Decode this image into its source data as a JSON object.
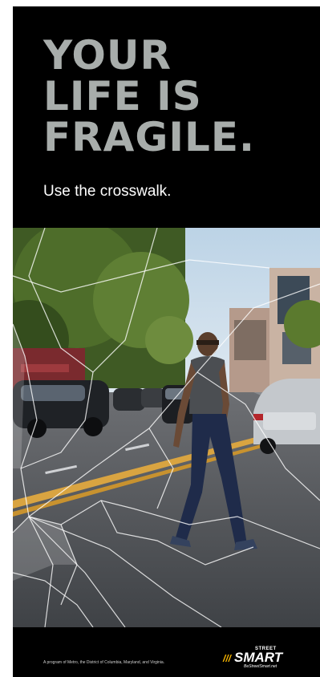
{
  "headline": {
    "line1": "YOUR",
    "line2": "LIFE IS",
    "line3": "FRAGILE."
  },
  "subhead": "Use the crosswalk.",
  "footer": {
    "text": "A program of Metro, the District of Columbia, Maryland, and Virginia."
  },
  "logo": {
    "street": "STREET",
    "bars": "///",
    "smart": "SMART",
    "url": "BeStreetSmart.net"
  },
  "colors": {
    "poster_background": "#000000",
    "headline": "#a8adab",
    "subhead": "#ffffff",
    "logo_accent": "#f7b500"
  },
  "photo": {
    "description_icon": "pedestrian-crossing-photo-icon",
    "overlay_icon": "broken-glass-icon"
  }
}
